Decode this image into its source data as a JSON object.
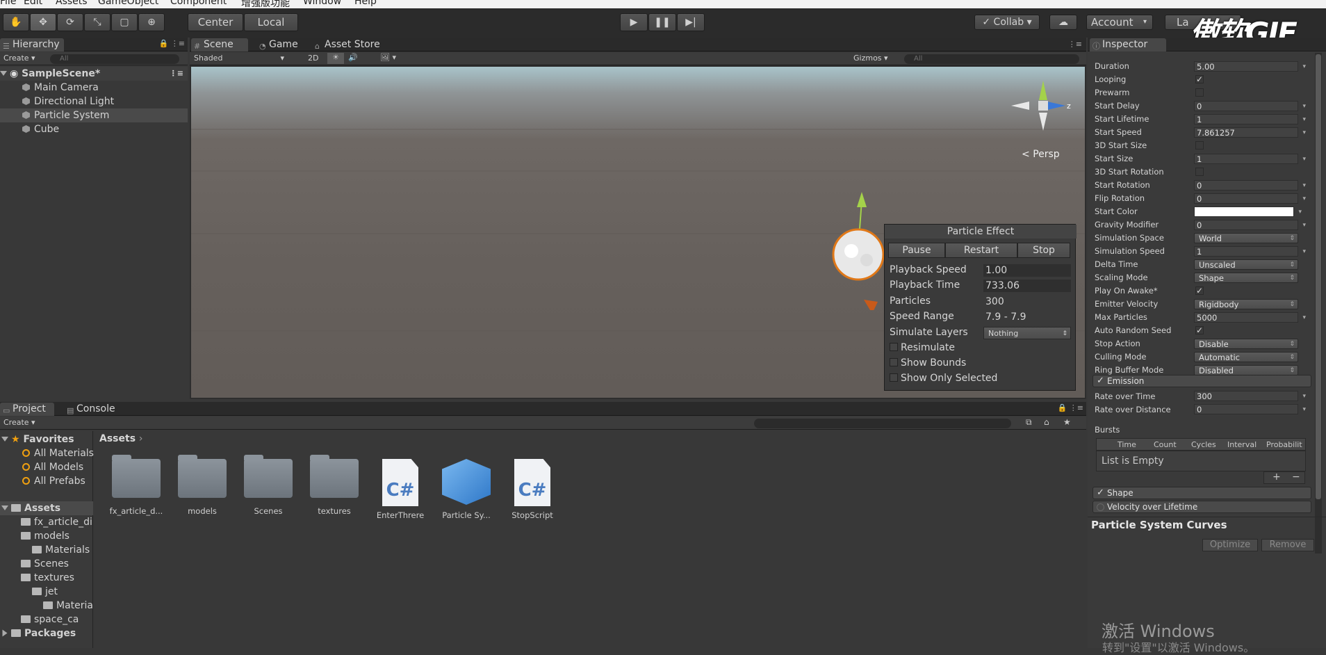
{
  "menu": [
    "File",
    "Edit",
    "Assets",
    "GameObject",
    "Component",
    "增强版功能",
    "Window",
    "Help"
  ],
  "toolbar": {
    "pivot": "Center",
    "space": "Local",
    "collab": "Collab",
    "account": "Account",
    "layers": "La",
    "watermark": "傲软GIF"
  },
  "hierarchy": {
    "tab": "Hierarchy",
    "create": "Create",
    "search": "All",
    "scene": "SampleScene*",
    "items": [
      "Main Camera",
      "Directional Light",
      "Particle System",
      "Cube"
    ]
  },
  "scene": {
    "tabs": [
      "Scene",
      "Game",
      "Asset Store"
    ],
    "shading": "Shaded",
    "mode2d": "2D",
    "gizmos": "Gizmos",
    "search": "All",
    "persp": "Persp",
    "axis_z": "z"
  },
  "particle_effect": {
    "title": "Particle Effect",
    "buttons": [
      "Pause",
      "Restart",
      "Stop"
    ],
    "fields": [
      {
        "label": "Playback Speed",
        "value": "1.00"
      },
      {
        "label": "Playback Time",
        "value": "733.06"
      },
      {
        "label": "Particles",
        "value": "300"
      },
      {
        "label": "Speed Range",
        "value": "7.9 - 7.9"
      },
      {
        "label": "Simulate Layers",
        "value": "Nothing"
      }
    ],
    "checks": [
      "Resimulate",
      "Show Bounds",
      "Show Only Selected"
    ]
  },
  "inspector": {
    "tab": "Inspector",
    "props": [
      {
        "label": "Duration",
        "value": "5.00",
        "kind": "box"
      },
      {
        "label": "Looping",
        "value": "✓",
        "kind": "check"
      },
      {
        "label": "Prewarm",
        "value": "",
        "kind": "check"
      },
      {
        "label": "Start Delay",
        "value": "0",
        "kind": "box"
      },
      {
        "label": "Start Lifetime",
        "value": "1",
        "kind": "box"
      },
      {
        "label": "Start Speed",
        "value": "7.861257",
        "kind": "box"
      },
      {
        "label": "3D Start Size",
        "value": "",
        "kind": "check"
      },
      {
        "label": "Start Size",
        "value": "1",
        "kind": "box"
      },
      {
        "label": "3D Start Rotation",
        "value": "",
        "kind": "check"
      },
      {
        "label": "Start Rotation",
        "value": "0",
        "kind": "box"
      },
      {
        "label": "Flip Rotation",
        "value": "0",
        "kind": "box"
      },
      {
        "label": "Start Color",
        "value": "",
        "kind": "color"
      },
      {
        "label": "Gravity Modifier",
        "value": "0",
        "kind": "box"
      },
      {
        "label": "Simulation Space",
        "value": "World",
        "kind": "drop"
      },
      {
        "label": "Simulation Speed",
        "value": "1",
        "kind": "box"
      },
      {
        "label": "Delta Time",
        "value": "Unscaled",
        "kind": "drop"
      },
      {
        "label": "Scaling Mode",
        "value": "Shape",
        "kind": "drop"
      },
      {
        "label": "Play On Awake*",
        "value": "✓",
        "kind": "check"
      },
      {
        "label": "Emitter Velocity",
        "value": "Rigidbody",
        "kind": "drop"
      },
      {
        "label": "Max Particles",
        "value": "5000",
        "kind": "box"
      },
      {
        "label": "Auto Random Seed",
        "value": "✓",
        "kind": "check"
      },
      {
        "label": "Stop Action",
        "value": "Disable",
        "kind": "drop"
      },
      {
        "label": "Culling Mode",
        "value": "Automatic",
        "kind": "drop"
      },
      {
        "label": "Ring Buffer Mode",
        "value": "Disabled",
        "kind": "drop"
      }
    ],
    "emission": "Emission",
    "emission_props": [
      {
        "label": "Rate over Time",
        "value": "300"
      },
      {
        "label": "Rate over Distance",
        "value": "0"
      }
    ],
    "bursts": "Bursts",
    "burst_cols": [
      "Time",
      "Count",
      "Cycles",
      "Interval",
      "Probabilit"
    ],
    "list_empty": "List is Empty",
    "plus": "+",
    "minus": "−",
    "shape": "Shape",
    "velocity": "Velocity over Lifetime",
    "curves_title": "Particle System Curves",
    "optimize": "Optimize",
    "remove": "Remove",
    "activate1": "激活 Windows",
    "activate2": "转到\"设置\"以激活 Windows。"
  },
  "project": {
    "tabs": [
      "Project",
      "Console"
    ],
    "create": "Create",
    "favorites": "Favorites",
    "fav_items": [
      "All Materials",
      "All Models",
      "All Prefabs"
    ],
    "assets_root": "Assets",
    "tree": [
      {
        "label": "fx_article_di",
        "indent": 1
      },
      {
        "label": "models",
        "indent": 1
      },
      {
        "label": "Materials",
        "indent": 2
      },
      {
        "label": "Scenes",
        "indent": 1
      },
      {
        "label": "textures",
        "indent": 1
      },
      {
        "label": "jet",
        "indent": 2
      },
      {
        "label": "Materia",
        "indent": 3
      },
      {
        "label": "space_ca",
        "indent": 1
      }
    ],
    "packages": "Packages",
    "breadcrumb": "Assets",
    "assets": [
      {
        "label": "fx_article_d...",
        "kind": "folder"
      },
      {
        "label": "models",
        "kind": "folder"
      },
      {
        "label": "Scenes",
        "kind": "folder"
      },
      {
        "label": "textures",
        "kind": "folder"
      },
      {
        "label": "EnterThrere",
        "kind": "cs"
      },
      {
        "label": "Particle Sy...",
        "kind": "prefab"
      },
      {
        "label": "StopScript",
        "kind": "cs"
      }
    ]
  }
}
